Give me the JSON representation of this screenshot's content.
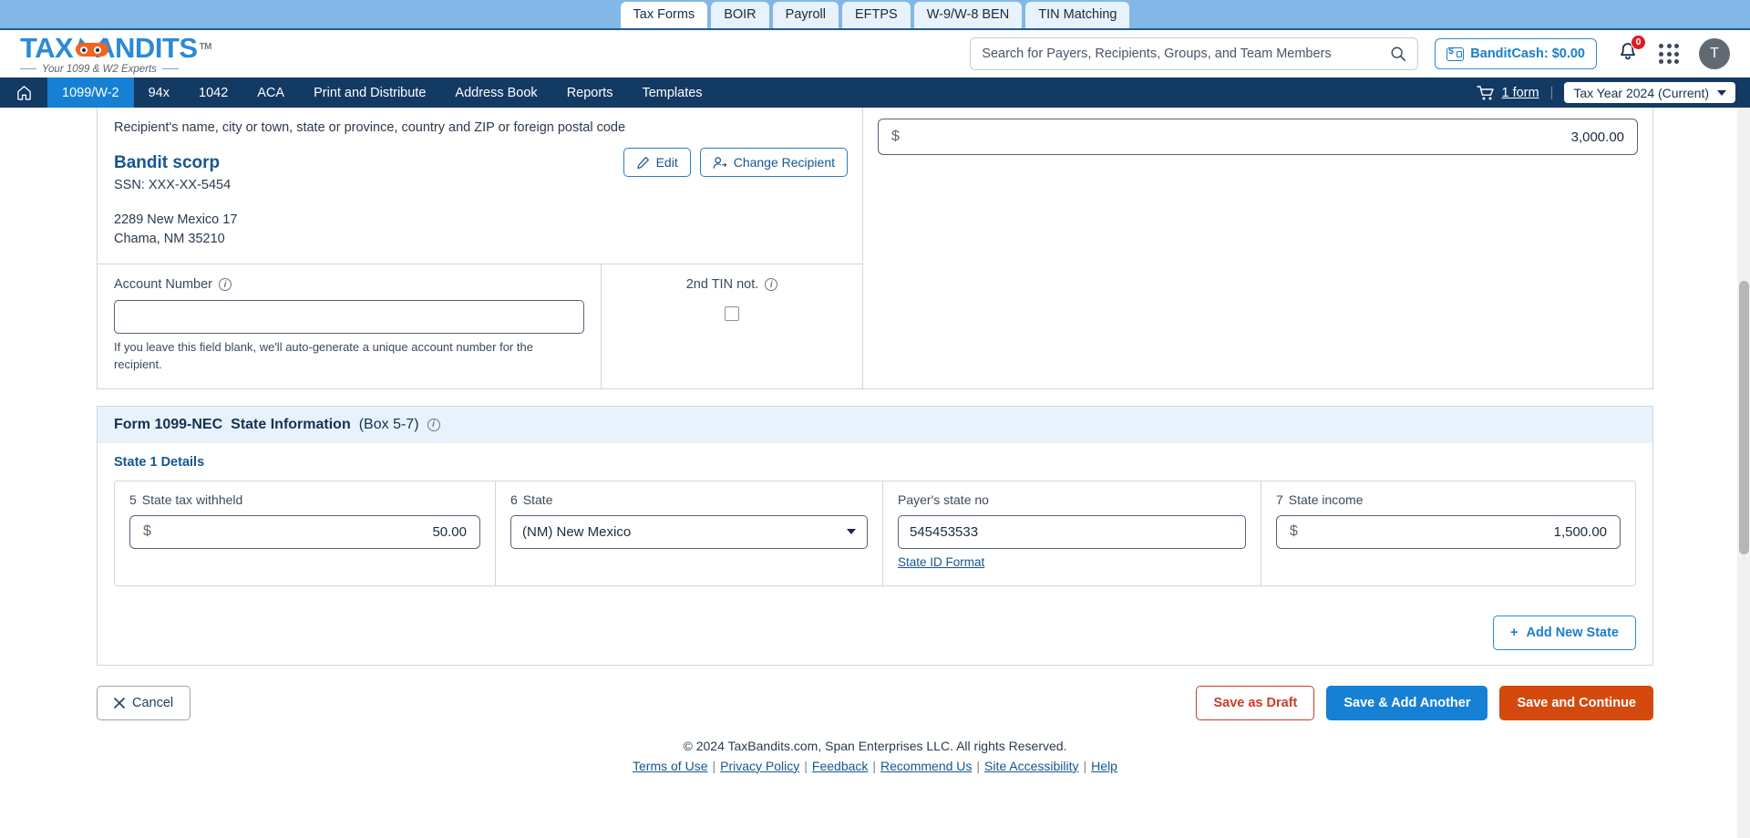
{
  "product_tabs": [
    {
      "label": "Tax Forms",
      "active": true
    },
    {
      "label": "BOIR",
      "active": false
    },
    {
      "label": "Payroll",
      "active": false
    },
    {
      "label": "EFTPS",
      "active": false
    },
    {
      "label": "W-9/W-8 BEN",
      "active": false
    },
    {
      "label": "TIN Matching",
      "active": false
    }
  ],
  "brand": {
    "name_part1": "TAX",
    "name_part2": "ANDITS",
    "tm": "TM",
    "tagline": "Your 1099 & W2 Experts"
  },
  "header": {
    "search_placeholder": "Search for Payers, Recipients, Groups, and Team Members",
    "search_value": "",
    "bandit_cash": "BanditCash: $0.00",
    "notification_count": "0",
    "avatar_initial": "T"
  },
  "nav": {
    "items": [
      {
        "label": "1099/W-2",
        "active": true
      },
      {
        "label": "94x",
        "active": false
      },
      {
        "label": "1042",
        "active": false
      },
      {
        "label": "ACA",
        "active": false
      },
      {
        "label": "Print and Distribute",
        "active": false
      },
      {
        "label": "Address Book",
        "active": false
      },
      {
        "label": "Reports",
        "active": false
      },
      {
        "label": "Templates",
        "active": false
      }
    ],
    "cart_label": "1 form",
    "divider": "|",
    "tax_year": "Tax Year 2024 (Current)"
  },
  "recipient": {
    "caption": "Recipient's name, city or town, state or province, country and ZIP or foreign postal code",
    "name": "Bandit scorp",
    "ssn": "SSN: XXX-XX-5454",
    "address_line1": "2289 New Mexico 17",
    "address_line2": "Chama, NM 35210",
    "edit_label": "Edit",
    "change_label": "Change Recipient"
  },
  "account": {
    "label": "Account Number",
    "value": "",
    "hint": "If you leave this field blank, we'll auto-generate a unique account number for the recipient."
  },
  "tin": {
    "label": "2nd TIN not.",
    "checked": false
  },
  "nonemployee_amount": {
    "dollar": "$",
    "value": "3,000.00"
  },
  "state_info": {
    "heading_form": "Form 1099-NEC",
    "heading_title": "State Information",
    "heading_box": "(Box 5-7)",
    "state1_title": "State 1 Details",
    "fields": {
      "state_tax_withheld": {
        "num": "5",
        "label": "State tax withheld",
        "dollar": "$",
        "value": "50.00"
      },
      "state": {
        "num": "6",
        "label": "State",
        "value": "(NM) New Mexico"
      },
      "payer_state_no": {
        "label": "Payer's state no",
        "value": "545453533",
        "link": "State ID Format"
      },
      "state_income": {
        "num": "7",
        "label": "State income",
        "dollar": "$",
        "value": "1,500.00"
      }
    },
    "add_state_label": "Add New State",
    "add_state_plus": "+"
  },
  "actions": {
    "cancel": "Cancel",
    "save_draft": "Save as Draft",
    "save_add_another": "Save & Add Another",
    "save_continue": "Save and Continue"
  },
  "footer": {
    "copyright": "© 2024 TaxBandits.com, Span Enterprises LLC. All rights Reserved.",
    "links": [
      "Terms of Use",
      "Privacy Policy",
      "Feedback",
      "Recommend Us",
      "Site Accessibility",
      "Help"
    ],
    "separator": "|"
  },
  "colors": {
    "brand_blue": "#2c8ad6",
    "brand_orange": "#f1641e",
    "nav_dark": "#123a63",
    "accent_blue": "#1680d4",
    "danger_red": "#cf3b2b",
    "primary_orange": "#d4490d"
  }
}
